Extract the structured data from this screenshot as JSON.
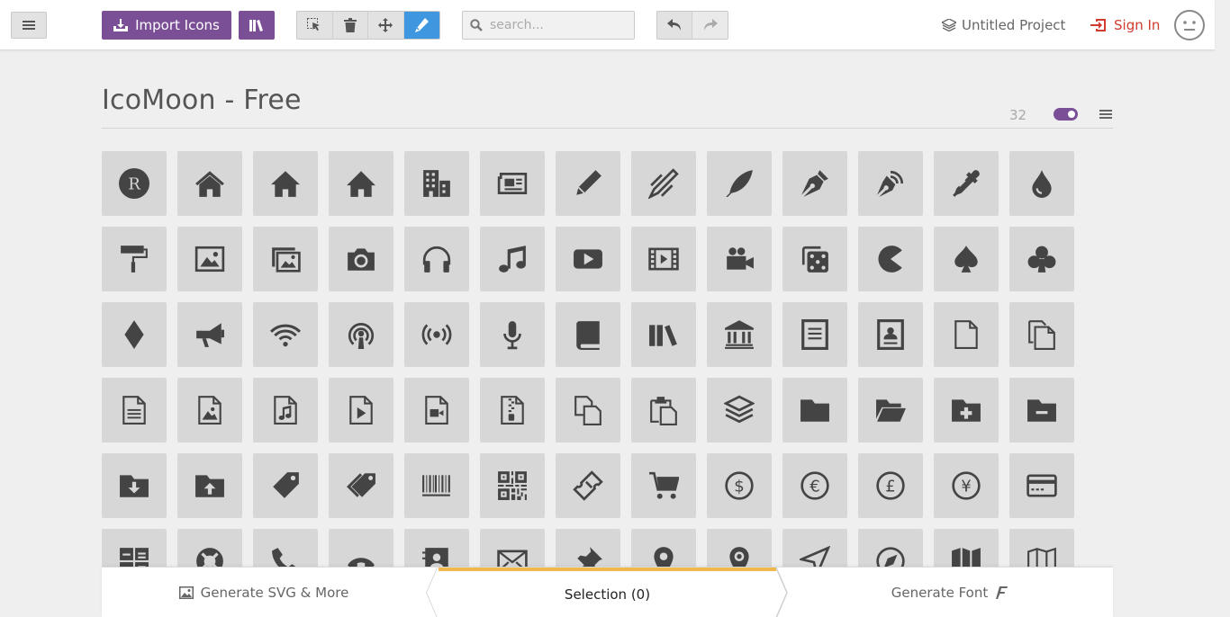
{
  "toolbar": {
    "import_label": "Import Icons",
    "search_placeholder": "search...",
    "project_name": "Untitled Project",
    "signin_label": "Sign In"
  },
  "set": {
    "title": "IcoMoon - Free",
    "icon_count": "32"
  },
  "icons": [
    "cx-logo",
    "home",
    "home2",
    "home3",
    "office",
    "newspaper",
    "pencil",
    "pencil2",
    "quill",
    "pen",
    "blog",
    "eyedropper",
    "droplet",
    "paint-format",
    "image",
    "images",
    "camera",
    "headphones",
    "music",
    "play",
    "film",
    "video-camera",
    "dice",
    "pacman",
    "spades",
    "clubs",
    "diamonds",
    "bullhorn",
    "connection",
    "podcast",
    "feed",
    "mic",
    "book",
    "books",
    "library",
    "file-text",
    "profile",
    "file-empty",
    "files-empty",
    "file-text2",
    "file-picture",
    "file-music",
    "file-play",
    "file-video",
    "file-zip",
    "copy",
    "paste",
    "stack",
    "folder",
    "folder-open",
    "folder-plus",
    "folder-minus",
    "folder-download",
    "folder-upload",
    "price-tag",
    "price-tags",
    "barcode",
    "qrcode",
    "ticket",
    "cart",
    "coin-dollar",
    "coin-euro",
    "coin-pound",
    "coin-yen",
    "credit-card",
    "calculator",
    "lifebuoy",
    "phone",
    "phone-hang-up",
    "address-book",
    "envelop",
    "pushpin",
    "location",
    "location2",
    "compass",
    "compass2",
    "map",
    "map2"
  ],
  "colors": {
    "accent_purple": "#7b4f96",
    "active_blue": "#3f97df",
    "signin_red": "#d03c2f",
    "selection_orange": "#f0b74a",
    "icon_fill": "#444444",
    "cell_bg": "#d7d7d7"
  },
  "bottom": {
    "generate_svg_label": "Generate SVG & More",
    "selection_label": "Selection (0)",
    "generate_font_label": "Generate Font"
  }
}
